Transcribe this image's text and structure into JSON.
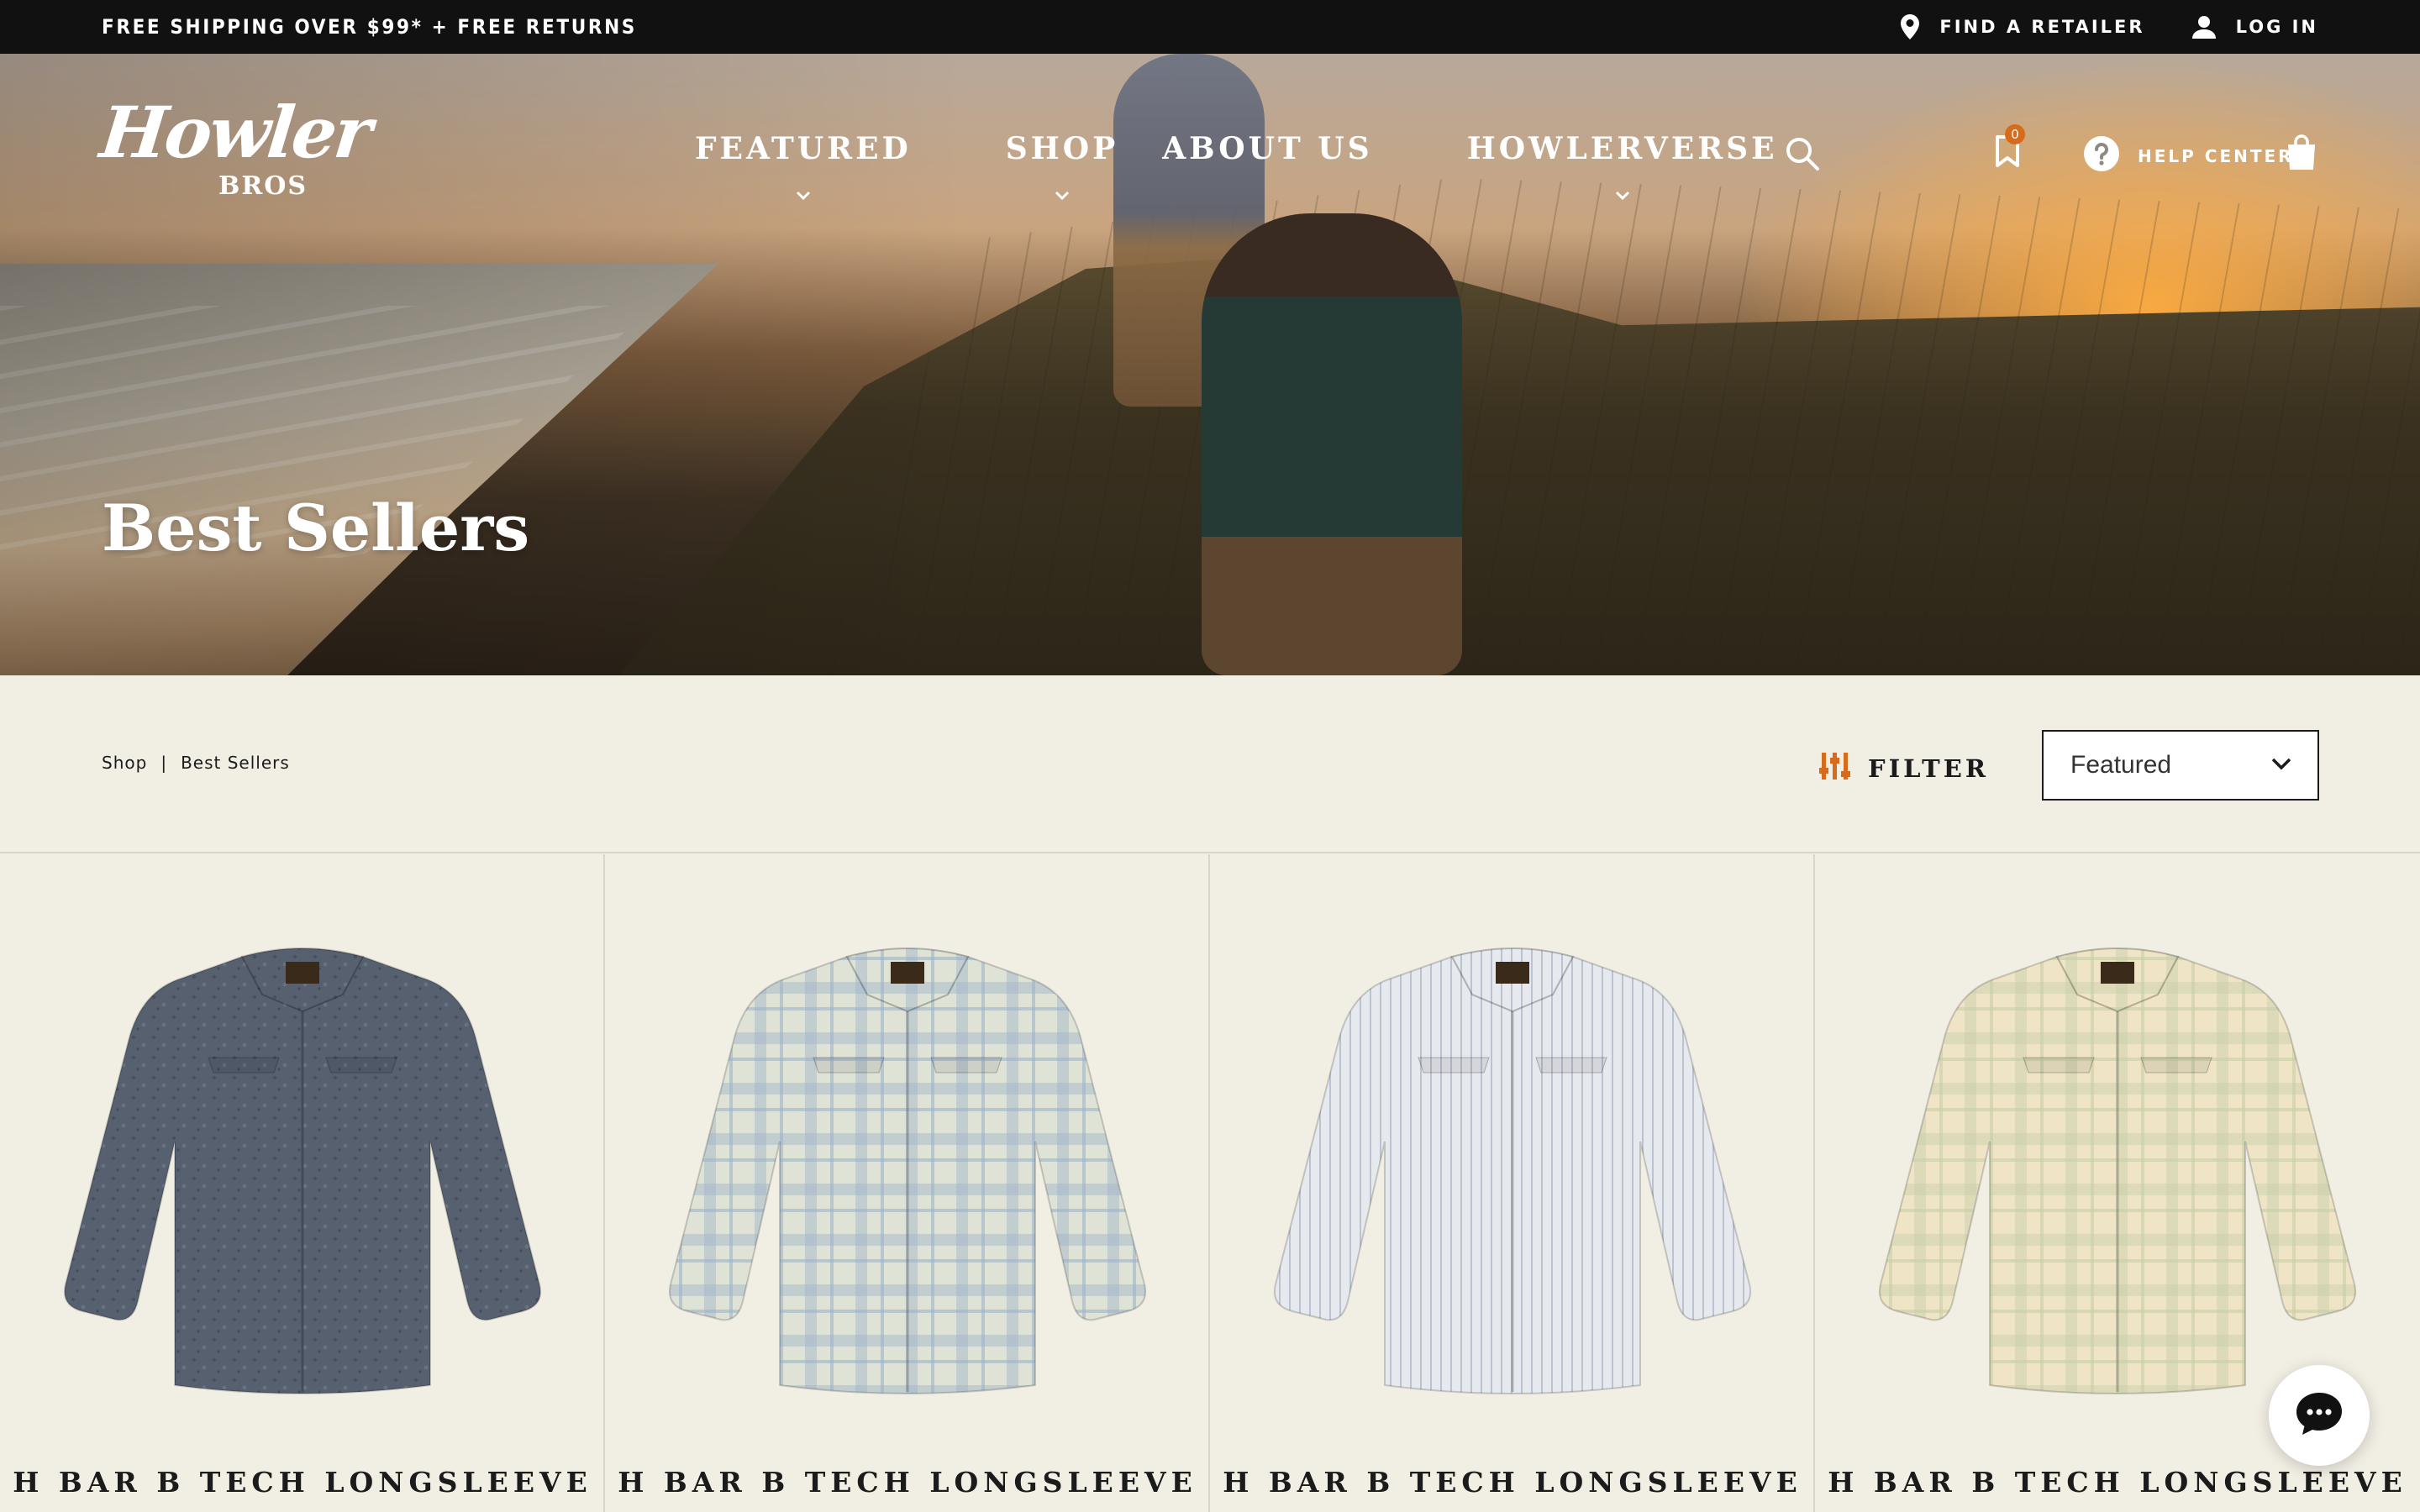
{
  "announcement": {
    "promo": "FREE SHIPPING OVER $99* + FREE RETURNS",
    "find_retailer": "FIND A RETAILER",
    "log_in": "LOG IN",
    "icons": [
      "map-pin-icon",
      "user-icon"
    ]
  },
  "header": {
    "logo_script": "Howler",
    "logo_sub": "BROS",
    "nav": [
      {
        "label": "FEATURED",
        "has_dropdown": true
      },
      {
        "label": "SHOP",
        "has_dropdown": true
      },
      {
        "label": "ABOUT US",
        "has_dropdown": false
      },
      {
        "label": "HOWLERVERSE",
        "has_dropdown": true
      }
    ],
    "wishlist_count": "0",
    "help_center": "HELP CENTER",
    "icons": [
      "search-icon",
      "bookmark-icon",
      "help-icon",
      "shopping-bag-icon"
    ]
  },
  "hero": {
    "title": "Best Sellers"
  },
  "toolbar": {
    "breadcrumb": [
      "Shop",
      "Best Sellers"
    ],
    "breadcrumb_separator": "|",
    "filter_label": "FILTER",
    "sort_value": "Featured"
  },
  "products": [
    {
      "title": "H BAR B TECH LONGSLEEVE",
      "color": "#56606f",
      "pattern": "print"
    },
    {
      "title": "H BAR B TECH LONGSLEEVE",
      "color": "#dfe3d6",
      "pattern": "plaid",
      "accent": "#9fb2c8"
    },
    {
      "title": "H BAR B TECH LONGSLEEVE",
      "color": "#e6e9ee",
      "pattern": "stripe",
      "accent": "#aab3c2"
    },
    {
      "title": "H BAR B TECH LONGSLEEVE",
      "color": "#efe4c6",
      "pattern": "plaid",
      "accent": "#c7cfa8"
    }
  ],
  "colors": {
    "accent": "#d76b1c",
    "background": "#f1eee4",
    "topbar": "#111111"
  }
}
